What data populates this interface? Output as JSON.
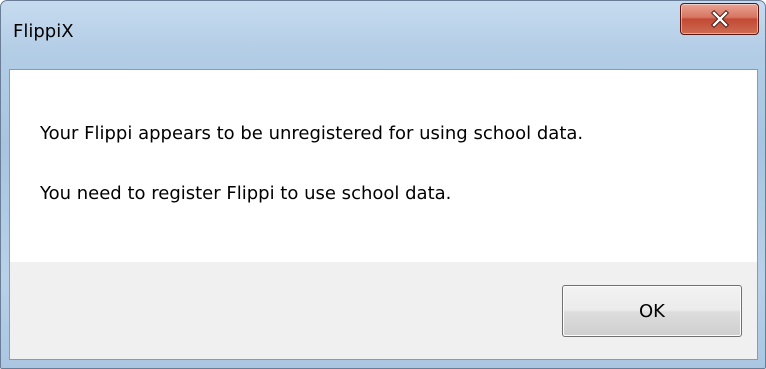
{
  "window": {
    "title": "FlippiX"
  },
  "title_bar": {
    "close_icon": "close-x-icon"
  },
  "message": {
    "line1": "Your Flippi appears to be unregistered for using school data.",
    "line2": "You need to register Flippi to use school data."
  },
  "buttons": {
    "ok_label": "OK"
  },
  "colors": {
    "frame": "#b3cde6",
    "close_button": "#c14a34",
    "footer": "#f0f0f0"
  }
}
